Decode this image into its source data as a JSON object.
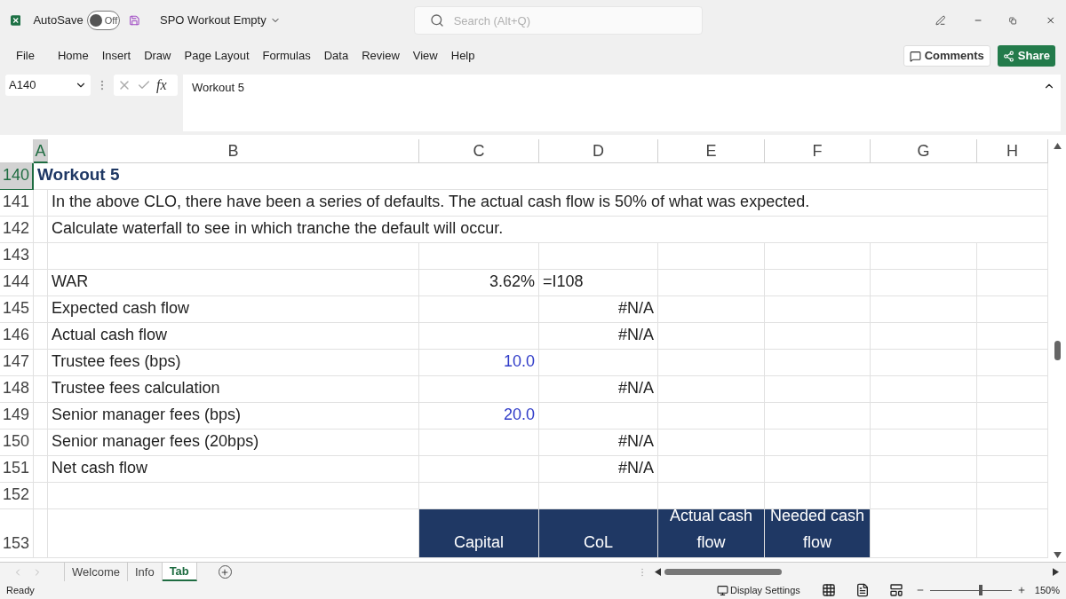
{
  "title_bar": {
    "autosave_label": "AutoSave",
    "autosave_state": "Off",
    "autosave_on": false,
    "file_name": "SPO Workout Empty",
    "search_placeholder": "Search (Alt+Q)"
  },
  "menu": [
    {
      "label": "File",
      "selected": false
    },
    {
      "label": "Home",
      "selected": false
    },
    {
      "label": "Insert",
      "selected": false
    },
    {
      "label": "Draw",
      "selected": false
    },
    {
      "label": "Page Layout",
      "selected": false
    },
    {
      "label": "Formulas",
      "selected": false
    },
    {
      "label": "Data",
      "selected": false
    },
    {
      "label": "Review",
      "selected": false
    },
    {
      "label": "View",
      "selected": false
    },
    {
      "label": "Help",
      "selected": false
    }
  ],
  "actions": {
    "comments": "Comments",
    "share": "Share"
  },
  "formula_bar": {
    "name_box": "A140",
    "fx": "fx",
    "value": "Workout 5"
  },
  "columns": [
    {
      "label": "A",
      "selected": true
    },
    {
      "label": "B",
      "selected": false
    },
    {
      "label": "C",
      "selected": false
    },
    {
      "label": "D",
      "selected": false
    },
    {
      "label": "E",
      "selected": false
    },
    {
      "label": "F",
      "selected": false
    },
    {
      "label": "G",
      "selected": false
    },
    {
      "label": "H",
      "selected": false
    }
  ],
  "rows": [
    {
      "number": "140",
      "selected": true,
      "cells": [
        {
          "kind": "title",
          "text": "Workout 5"
        },
        {
          "kind": "empty"
        },
        {
          "kind": "empty"
        },
        {
          "kind": "empty"
        },
        {
          "kind": "empty"
        },
        {
          "kind": "empty"
        },
        {
          "kind": "empty"
        },
        {
          "kind": "empty"
        }
      ]
    },
    {
      "number": "141",
      "selected": false,
      "cells": [
        {
          "kind": "empty"
        },
        {
          "kind": "text",
          "text": "In the above CLO, there have been a series of defaults.  The actual cash flow is 50% of what was expected."
        },
        {
          "kind": "empty"
        },
        {
          "kind": "empty"
        },
        {
          "kind": "empty"
        },
        {
          "kind": "empty"
        },
        {
          "kind": "empty"
        },
        {
          "kind": "empty"
        }
      ]
    },
    {
      "number": "142",
      "selected": false,
      "cells": [
        {
          "kind": "empty"
        },
        {
          "kind": "text",
          "text": "Calculate waterfall to see in which tranche the default will occur."
        },
        {
          "kind": "empty"
        },
        {
          "kind": "empty"
        },
        {
          "kind": "empty"
        },
        {
          "kind": "empty"
        },
        {
          "kind": "empty"
        },
        {
          "kind": "empty"
        }
      ]
    },
    {
      "number": "143",
      "selected": false,
      "cells": [
        {
          "kind": "empty"
        },
        {
          "kind": "empty"
        },
        {
          "kind": "empty"
        },
        {
          "kind": "empty"
        },
        {
          "kind": "empty"
        },
        {
          "kind": "empty"
        },
        {
          "kind": "empty"
        },
        {
          "kind": "empty"
        }
      ]
    },
    {
      "number": "144",
      "selected": false,
      "cells": [
        {
          "kind": "empty"
        },
        {
          "kind": "text",
          "text": "WAR"
        },
        {
          "kind": "number",
          "text": "3.62%"
        },
        {
          "kind": "text",
          "text": "=I108"
        },
        {
          "kind": "empty"
        },
        {
          "kind": "empty"
        },
        {
          "kind": "empty"
        },
        {
          "kind": "empty"
        }
      ]
    },
    {
      "number": "145",
      "selected": false,
      "cells": [
        {
          "kind": "empty"
        },
        {
          "kind": "text",
          "text": "Expected cash flow"
        },
        {
          "kind": "empty"
        },
        {
          "kind": "number",
          "text": "#N/A"
        },
        {
          "kind": "empty"
        },
        {
          "kind": "empty"
        },
        {
          "kind": "empty"
        },
        {
          "kind": "empty"
        }
      ]
    },
    {
      "number": "146",
      "selected": false,
      "cells": [
        {
          "kind": "empty"
        },
        {
          "kind": "text",
          "text": "Actual cash flow"
        },
        {
          "kind": "empty"
        },
        {
          "kind": "number",
          "text": "#N/A"
        },
        {
          "kind": "empty"
        },
        {
          "kind": "empty"
        },
        {
          "kind": "empty"
        },
        {
          "kind": "empty"
        }
      ]
    },
    {
      "number": "147",
      "selected": false,
      "cells": [
        {
          "kind": "empty"
        },
        {
          "kind": "text",
          "text": "Trustee fees (bps)"
        },
        {
          "kind": "input",
          "text": "10.0"
        },
        {
          "kind": "empty"
        },
        {
          "kind": "empty"
        },
        {
          "kind": "empty"
        },
        {
          "kind": "empty"
        },
        {
          "kind": "empty"
        }
      ]
    },
    {
      "number": "148",
      "selected": false,
      "cells": [
        {
          "kind": "empty"
        },
        {
          "kind": "text",
          "text": "Trustee fees calculation"
        },
        {
          "kind": "empty"
        },
        {
          "kind": "number",
          "text": "#N/A"
        },
        {
          "kind": "empty"
        },
        {
          "kind": "empty"
        },
        {
          "kind": "empty"
        },
        {
          "kind": "empty"
        }
      ]
    },
    {
      "number": "149",
      "selected": false,
      "cells": [
        {
          "kind": "empty"
        },
        {
          "kind": "text",
          "text": "Senior manager fees (bps)"
        },
        {
          "kind": "input",
          "text": "20.0"
        },
        {
          "kind": "empty"
        },
        {
          "kind": "empty"
        },
        {
          "kind": "empty"
        },
        {
          "kind": "empty"
        },
        {
          "kind": "empty"
        }
      ]
    },
    {
      "number": "150",
      "selected": false,
      "cells": [
        {
          "kind": "empty"
        },
        {
          "kind": "text",
          "text": "Senior manager fees (20bps)"
        },
        {
          "kind": "empty"
        },
        {
          "kind": "number",
          "text": "#N/A"
        },
        {
          "kind": "empty"
        },
        {
          "kind": "empty"
        },
        {
          "kind": "empty"
        },
        {
          "kind": "empty"
        }
      ]
    },
    {
      "number": "151",
      "selected": false,
      "cells": [
        {
          "kind": "empty"
        },
        {
          "kind": "text",
          "text": "Net cash flow"
        },
        {
          "kind": "empty"
        },
        {
          "kind": "number",
          "text": "#N/A"
        },
        {
          "kind": "empty"
        },
        {
          "kind": "empty"
        },
        {
          "kind": "empty"
        },
        {
          "kind": "empty"
        }
      ]
    },
    {
      "number": "152",
      "selected": false,
      "cells": [
        {
          "kind": "empty"
        },
        {
          "kind": "empty"
        },
        {
          "kind": "empty"
        },
        {
          "kind": "empty"
        },
        {
          "kind": "empty"
        },
        {
          "kind": "empty"
        },
        {
          "kind": "empty"
        },
        {
          "kind": "empty"
        }
      ]
    },
    {
      "number": "153",
      "selected": false,
      "cells": [
        {
          "kind": "empty"
        },
        {
          "kind": "empty"
        },
        {
          "kind": "header",
          "text": "Capital"
        },
        {
          "kind": "header",
          "text": "CoL"
        },
        {
          "kind": "header",
          "text": "Actual cash flow"
        },
        {
          "kind": "header",
          "text": "Needed cash flow"
        },
        {
          "kind": "empty"
        },
        {
          "kind": "empty"
        }
      ]
    }
  ],
  "sheets": [
    {
      "label": "Welcome",
      "selected": false
    },
    {
      "label": "Info",
      "selected": false
    },
    {
      "label": "Tab",
      "selected": true
    }
  ],
  "status_bar": {
    "status": "Ready",
    "display_settings": "Display Settings",
    "zoom": "150%"
  },
  "zoom_slider": {
    "level": 0.6
  }
}
